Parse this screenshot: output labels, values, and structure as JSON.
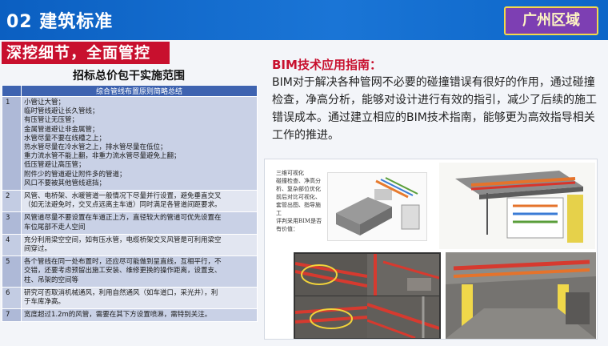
{
  "header": {
    "title": "02 建筑标准",
    "region": "广州区域"
  },
  "banner": "深挖细节，全面管控",
  "table": {
    "title": "招标总价包干实施范围",
    "column_header": "综合管线布置原则简略总结",
    "rows": [
      {
        "num": "1",
        "lines": [
          "小管让大管；",
          "临时管线避让长久管线；",
          "有压管让无压管；",
          "金属管道避让非金属管；",
          "水管尽量不要在线槽之上；",
          "热水管尽量在冷水管之上，排水管尽量在低位；",
          "重力流水管不能上翻，非重力流水管尽量避免上翻；",
          "低压管避让高压管；",
          "附件少的管道避让附件多的管道；",
          "风口不要被其他管线遮挡；"
        ]
      },
      {
        "num": "2",
        "lines": [
          "风管、电桥架、水暖管道一般情况下尽量并行设置，避免垂直交叉",
          "（如无法避免时，交叉点远离主车道）同时满足各管道间距要求。"
        ]
      },
      {
        "num": "3",
        "lines": [
          "风管道尽量不要设置在车道正上方，直径较大的管道可优先设置在",
          "车位尾部不走人空间"
        ]
      },
      {
        "num": "4",
        "lines": [
          "充分利用梁空空间，如有压水管，电缆桥架交叉风管是可利用梁空",
          "间穿过。"
        ]
      },
      {
        "num": "5",
        "lines": [
          "各个管线在同一处布置时，还应尽可能做到呈直线，互相平行，不",
          "交错，还要考虑预留出施工安装、维修更换的操作距离，设置支、",
          "柱、吊架的空间等"
        ]
      },
      {
        "num": "6",
        "lines": [
          "研究可否取消机械通风，利用自然通风（如车道口，采光井），利",
          "于车库净高。"
        ]
      },
      {
        "num": "7",
        "lines": [
          "宽度超过1.2m的风管，需要在其下方设置喷淋，需特别关注。"
        ]
      }
    ]
  },
  "bim": {
    "title": "BIM技术应用指南：",
    "body": "BIM对于解决各种管网不必要的碰撞错误有很好的作用，通过碰撞检查，净高分析，能够对设计进行有效的指引，减少了后续的施工错误成本。通过建立相应的BIM技术指南，能够更为高效指导相关工作的推进。"
  },
  "doc_excerpt": {
    "lines": [
      "三维可视化",
      "碰撞检查、净高分",
      "析、复杂部位优化",
      "前后对比可视化、",
      "套管出图、指导施",
      "工",
      "评判采用BIM是否",
      "有价值："
    ]
  },
  "colors": {
    "header_blue": "#0b5fc1",
    "region_purple": "#7d3fb3",
    "banner_red": "#c8102e",
    "table_header": "#3e63b0"
  }
}
